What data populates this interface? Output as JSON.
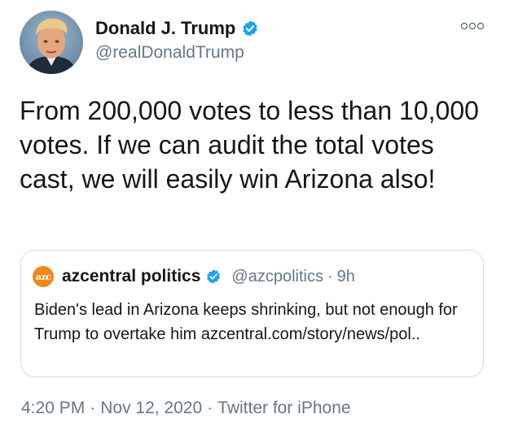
{
  "author": {
    "display_name": "Donald J. Trump",
    "handle": "@realDonaldTrump",
    "verified": true,
    "avatar_icon": "profile-photo"
  },
  "more_icon": "ooo",
  "tweet": {
    "text": "From 200,000 votes to less than 10,000 votes. If we can audit the total votes cast, we will easily win Arizona also!"
  },
  "quoted_tweet": {
    "avatar_text": "azc",
    "display_name": "azcentral politics",
    "handle": "@azcpolitics",
    "separator": "·",
    "time": "9h",
    "text": "Biden's lead in Arizona keeps shrinking, but not enough for Trump to overtake him azcentral.com/story/news/pol.."
  },
  "meta": {
    "time": "4:20 PM",
    "separator": "·",
    "date": "Nov 12, 2020",
    "source": "Twitter for iPhone"
  },
  "colors": {
    "verified_blue": "#1da1f2",
    "secondary_text": "#657786",
    "primary_text": "#14171a",
    "card_border": "#cfd9de",
    "azc_orange": "#ef8a1a"
  }
}
